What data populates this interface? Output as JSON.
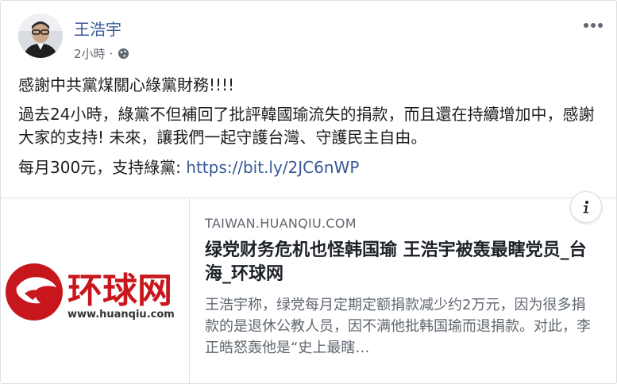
{
  "post": {
    "author": "王浩宇",
    "time": "2小時",
    "dot": "·",
    "paragraph1": "感謝中共黨煤關心綠黨財務!!!!",
    "paragraph2": "過去24小時，綠黨不但補回了批評韓國瑜流失的捐款，而且還在持續增加中，感謝大家的支持! 未來，讓我們一起守護台灣、守護民主自由。",
    "paragraph3_prefix": "每月300元，支持綠黨: ",
    "paragraph3_link": "https://bit.ly/2JC6nWP"
  },
  "icons": {
    "privacy": "globe-icon",
    "more": "more-options-icon",
    "info": "info-icon"
  },
  "link_card": {
    "logo_text": "环球网",
    "logo_url_text": "www.huanqiu.com",
    "domain": "TAIWAN.HUANQIU.COM",
    "title": "绿党财务危机也怪韩国瑜 王浩宇被轰最瞎党员_台海_环球网",
    "description": "王浩宇称，绿党每月定期定额捐款减少约2万元，因为很多捐款的是退休公教人员，因不满他批韩国瑜而退捐款。对此，李正皓怒轰他是“史上最瞎…"
  },
  "colors": {
    "link": "#385898",
    "logo_red": "#c8161d",
    "meta_gray": "#606770"
  }
}
